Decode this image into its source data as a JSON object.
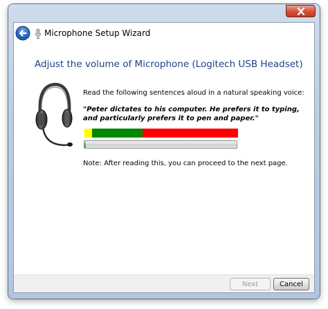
{
  "window": {
    "title": "Microphone Setup Wizard"
  },
  "titlebar": {
    "close_icon": "close-icon",
    "back_icon": "back-arrow-icon",
    "app_icon": "microphone-icon"
  },
  "content": {
    "heading": "Adjust the volume of Microphone (Logitech USB Headset)",
    "illustration_icon": "headset-icon",
    "instruction": "Read the following sentences aloud in a natural speaking voice:",
    "quote": "\"Peter dictates to his computer. He prefers it to typing, and particularly prefers it to pen and paper.\"",
    "note": "Note: After reading this, you can proceed to the next page."
  },
  "level_meter": {
    "segments": [
      {
        "color": "#ffff00",
        "fraction": 0.05
      },
      {
        "color": "#008800",
        "fraction": 0.33
      },
      {
        "color": "#ff0000",
        "fraction": 0.62
      }
    ]
  },
  "progress": {
    "value": 0.01,
    "color": "#2fbf1f"
  },
  "footer": {
    "next_label": "Next",
    "next_enabled": false,
    "cancel_label": "Cancel"
  }
}
